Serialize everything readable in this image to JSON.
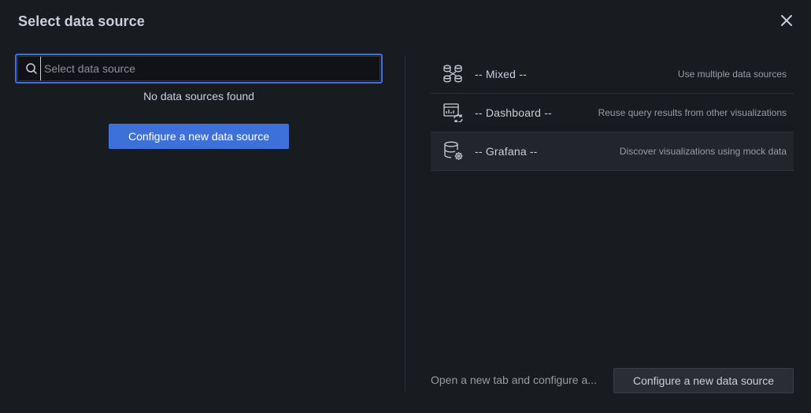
{
  "modal": {
    "title": "Select data source",
    "close_icon": "close-icon"
  },
  "search": {
    "placeholder": "Select data source",
    "value": "",
    "icon": "search-icon"
  },
  "left_pane": {
    "empty_message": "No data sources found",
    "configure_button_label": "Configure a new data source"
  },
  "built_in_sources": [
    {
      "name": "-- Mixed --",
      "description": "Use multiple data sources",
      "icon": "mixed-icon",
      "selected": false
    },
    {
      "name": "-- Dashboard --",
      "description": "Reuse query results from other visualizations",
      "icon": "dashboard-icon",
      "selected": false
    },
    {
      "name": "-- Grafana --",
      "description": "Discover visualizations using mock data",
      "icon": "grafana-icon",
      "selected": true
    }
  ],
  "footer": {
    "text": "Open a new tab and configure a...",
    "configure_button_label": "Configure a new data source"
  },
  "colors": {
    "background": "#181b1f",
    "accent": "#3d71d9",
    "text": "#ccccdc",
    "secondary_text": "#9a9ba3"
  }
}
